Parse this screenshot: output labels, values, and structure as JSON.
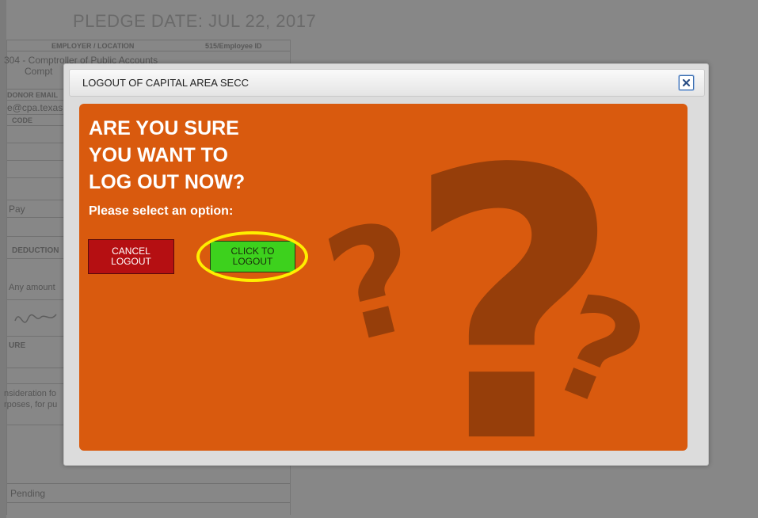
{
  "background": {
    "pledge_date": "PLEDGE DATE: JUL 22, 2017",
    "col_employer": "EMPLOYER / LOCATION",
    "col_employee_id": "515/Employee ID",
    "employer_line1": "304 - Comptroller of Public Accounts",
    "employer_line2": "Compt",
    "donor_email_label": "DONOR EMAIL",
    "email_value": "e@cpa.texas",
    "code_label": "CODE",
    "pay_label": "Pay",
    "deduction_label": "DEDUCTION",
    "any_amount": "Any amount",
    "signature_label": "URE",
    "consideration_line1": "nsideration fo",
    "consideration_line2": "rposes, for pu",
    "pending": "Pending"
  },
  "modal": {
    "title": "LOGOUT OF CAPITAL AREA SECC",
    "close_label": "×",
    "headline_line1": "ARE YOU SURE",
    "headline_line2": "YOU WANT TO",
    "headline_line3": "LOG OUT NOW?",
    "subhead": "Please select an option:",
    "cancel_line1": "CANCEL",
    "cancel_line2": "LOGOUT",
    "logout_line1": "CLICK TO",
    "logout_line2": "LOGOUT"
  },
  "colors": {
    "panel": "#d95a0e",
    "question_marks": "#8a3a09",
    "cancel_button": "#b50f12",
    "logout_button": "#3dd11d",
    "highlight_ring": "#ffee00"
  },
  "icons": {
    "close": "close-icon",
    "decor": "question-mark-icon"
  }
}
